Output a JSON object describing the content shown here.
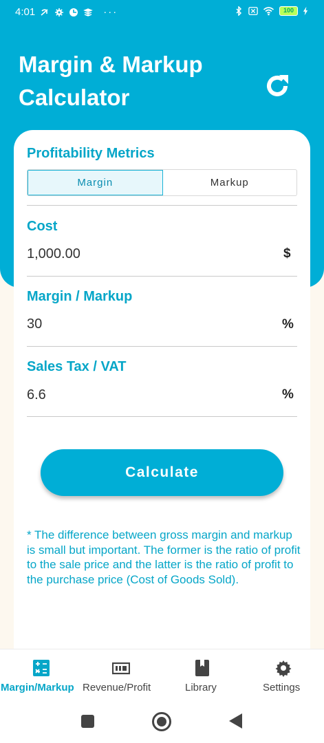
{
  "status_bar": {
    "time": "4:01",
    "battery": "100"
  },
  "header": {
    "title": "Margin & Markup Calculator"
  },
  "card": {
    "section_title": "Profitability Metrics",
    "tabs": [
      {
        "label": "Margin",
        "active": true
      },
      {
        "label": "Markup",
        "active": false
      }
    ],
    "fields": [
      {
        "label": "Cost",
        "value": "1,000.00",
        "unit": "$"
      },
      {
        "label": "Margin / Markup",
        "value": "30",
        "unit": "%"
      },
      {
        "label": "Sales Tax / VAT",
        "value": "6.6",
        "unit": "%"
      }
    ],
    "calculate_label": "Calculate",
    "note": "* The difference between gross margin and markup is small but important. The former is the ratio of profit to the sale price and the latter is the ratio of profit to the purchase price (Cost of Goods Sold)."
  },
  "bottom_nav": [
    {
      "label": "Margin/Markup",
      "icon": "calculator-icon",
      "active": true
    },
    {
      "label": "Revenue/Profit",
      "icon": "banknote-icon",
      "active": false
    },
    {
      "label": "Library",
      "icon": "book-icon",
      "active": false
    },
    {
      "label": "Settings",
      "icon": "gear-icon",
      "active": false
    }
  ],
  "colors": {
    "primary": "#00aed6",
    "accent_text": "#06a6c8",
    "background": "#fdf8ef"
  }
}
